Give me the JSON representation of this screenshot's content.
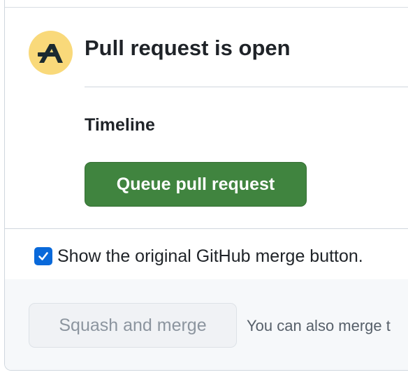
{
  "header": {
    "title": "Pull request is open",
    "logo_icon": "mergify-logo-icon",
    "logo_bg_color": "#f9d97a"
  },
  "timeline": {
    "label": "Timeline",
    "queue_button_label": "Queue pull request",
    "queue_button_color": "#40843f"
  },
  "options": {
    "show_merge_checked": true,
    "show_merge_label": "Show the original GitHub merge button.",
    "checkbox_color": "#0969da"
  },
  "merge": {
    "squash_button_label": "Squash and merge",
    "note": "You can also merge t"
  }
}
